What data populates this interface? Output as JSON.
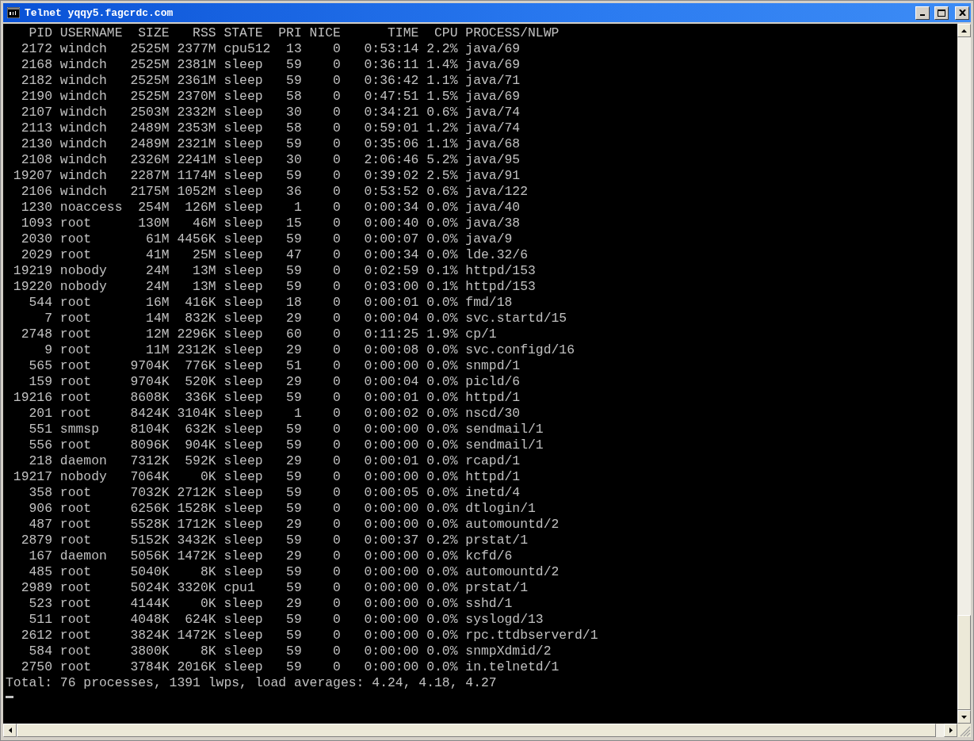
{
  "window": {
    "title": "Telnet yqqy5.fagcrdc.com"
  },
  "header": {
    "pid": "PID",
    "username": "USERNAME",
    "size": "SIZE",
    "rss": "RSS",
    "state": "STATE",
    "pri": "PRI",
    "nice": "NICE",
    "time": "TIME",
    "cpu": "CPU",
    "process": "PROCESS/NLWP"
  },
  "rows": [
    {
      "pid": "2172",
      "username": "windch",
      "size": "2525M",
      "rss": "2377M",
      "state": "cpu512",
      "pri": "13",
      "nice": "0",
      "time": "0:53:14",
      "cpu": "2.2%",
      "process": "java/69"
    },
    {
      "pid": "2168",
      "username": "windch",
      "size": "2525M",
      "rss": "2381M",
      "state": "sleep",
      "pri": "59",
      "nice": "0",
      "time": "0:36:11",
      "cpu": "1.4%",
      "process": "java/69"
    },
    {
      "pid": "2182",
      "username": "windch",
      "size": "2525M",
      "rss": "2361M",
      "state": "sleep",
      "pri": "59",
      "nice": "0",
      "time": "0:36:42",
      "cpu": "1.1%",
      "process": "java/71"
    },
    {
      "pid": "2190",
      "username": "windch",
      "size": "2525M",
      "rss": "2370M",
      "state": "sleep",
      "pri": "58",
      "nice": "0",
      "time": "0:47:51",
      "cpu": "1.5%",
      "process": "java/69"
    },
    {
      "pid": "2107",
      "username": "windch",
      "size": "2503M",
      "rss": "2332M",
      "state": "sleep",
      "pri": "30",
      "nice": "0",
      "time": "0:34:21",
      "cpu": "0.6%",
      "process": "java/74"
    },
    {
      "pid": "2113",
      "username": "windch",
      "size": "2489M",
      "rss": "2353M",
      "state": "sleep",
      "pri": "58",
      "nice": "0",
      "time": "0:59:01",
      "cpu": "1.2%",
      "process": "java/74"
    },
    {
      "pid": "2130",
      "username": "windch",
      "size": "2489M",
      "rss": "2321M",
      "state": "sleep",
      "pri": "59",
      "nice": "0",
      "time": "0:35:06",
      "cpu": "1.1%",
      "process": "java/68"
    },
    {
      "pid": "2108",
      "username": "windch",
      "size": "2326M",
      "rss": "2241M",
      "state": "sleep",
      "pri": "30",
      "nice": "0",
      "time": "2:06:46",
      "cpu": "5.2%",
      "process": "java/95"
    },
    {
      "pid": "19207",
      "username": "windch",
      "size": "2287M",
      "rss": "1174M",
      "state": "sleep",
      "pri": "59",
      "nice": "0",
      "time": "0:39:02",
      "cpu": "2.5%",
      "process": "java/91"
    },
    {
      "pid": "2106",
      "username": "windch",
      "size": "2175M",
      "rss": "1052M",
      "state": "sleep",
      "pri": "36",
      "nice": "0",
      "time": "0:53:52",
      "cpu": "0.6%",
      "process": "java/122"
    },
    {
      "pid": "1230",
      "username": "noaccess",
      "size": "254M",
      "rss": "126M",
      "state": "sleep",
      "pri": "1",
      "nice": "0",
      "time": "0:00:34",
      "cpu": "0.0%",
      "process": "java/40"
    },
    {
      "pid": "1093",
      "username": "root",
      "size": "130M",
      "rss": "46M",
      "state": "sleep",
      "pri": "15",
      "nice": "0",
      "time": "0:00:40",
      "cpu": "0.0%",
      "process": "java/38"
    },
    {
      "pid": "2030",
      "username": "root",
      "size": "61M",
      "rss": "4456K",
      "state": "sleep",
      "pri": "59",
      "nice": "0",
      "time": "0:00:07",
      "cpu": "0.0%",
      "process": "java/9"
    },
    {
      "pid": "2029",
      "username": "root",
      "size": "41M",
      "rss": "25M",
      "state": "sleep",
      "pri": "47",
      "nice": "0",
      "time": "0:00:34",
      "cpu": "0.0%",
      "process": "lde.32/6"
    },
    {
      "pid": "19219",
      "username": "nobody",
      "size": "24M",
      "rss": "13M",
      "state": "sleep",
      "pri": "59",
      "nice": "0",
      "time": "0:02:59",
      "cpu": "0.1%",
      "process": "httpd/153"
    },
    {
      "pid": "19220",
      "username": "nobody",
      "size": "24M",
      "rss": "13M",
      "state": "sleep",
      "pri": "59",
      "nice": "0",
      "time": "0:03:00",
      "cpu": "0.1%",
      "process": "httpd/153"
    },
    {
      "pid": "544",
      "username": "root",
      "size": "16M",
      "rss": "416K",
      "state": "sleep",
      "pri": "18",
      "nice": "0",
      "time": "0:00:01",
      "cpu": "0.0%",
      "process": "fmd/18"
    },
    {
      "pid": "7",
      "username": "root",
      "size": "14M",
      "rss": "832K",
      "state": "sleep",
      "pri": "29",
      "nice": "0",
      "time": "0:00:04",
      "cpu": "0.0%",
      "process": "svc.startd/15"
    },
    {
      "pid": "2748",
      "username": "root",
      "size": "12M",
      "rss": "2296K",
      "state": "sleep",
      "pri": "60",
      "nice": "0",
      "time": "0:11:25",
      "cpu": "1.9%",
      "process": "cp/1"
    },
    {
      "pid": "9",
      "username": "root",
      "size": "11M",
      "rss": "2312K",
      "state": "sleep",
      "pri": "29",
      "nice": "0",
      "time": "0:00:08",
      "cpu": "0.0%",
      "process": "svc.configd/16"
    },
    {
      "pid": "565",
      "username": "root",
      "size": "9704K",
      "rss": "776K",
      "state": "sleep",
      "pri": "51",
      "nice": "0",
      "time": "0:00:00",
      "cpu": "0.0%",
      "process": "snmpd/1"
    },
    {
      "pid": "159",
      "username": "root",
      "size": "9704K",
      "rss": "520K",
      "state": "sleep",
      "pri": "29",
      "nice": "0",
      "time": "0:00:04",
      "cpu": "0.0%",
      "process": "picld/6"
    },
    {
      "pid": "19216",
      "username": "root",
      "size": "8608K",
      "rss": "336K",
      "state": "sleep",
      "pri": "59",
      "nice": "0",
      "time": "0:00:01",
      "cpu": "0.0%",
      "process": "httpd/1"
    },
    {
      "pid": "201",
      "username": "root",
      "size": "8424K",
      "rss": "3104K",
      "state": "sleep",
      "pri": "1",
      "nice": "0",
      "time": "0:00:02",
      "cpu": "0.0%",
      "process": "nscd/30"
    },
    {
      "pid": "551",
      "username": "smmsp",
      "size": "8104K",
      "rss": "632K",
      "state": "sleep",
      "pri": "59",
      "nice": "0",
      "time": "0:00:00",
      "cpu": "0.0%",
      "process": "sendmail/1"
    },
    {
      "pid": "556",
      "username": "root",
      "size": "8096K",
      "rss": "904K",
      "state": "sleep",
      "pri": "59",
      "nice": "0",
      "time": "0:00:00",
      "cpu": "0.0%",
      "process": "sendmail/1"
    },
    {
      "pid": "218",
      "username": "daemon",
      "size": "7312K",
      "rss": "592K",
      "state": "sleep",
      "pri": "29",
      "nice": "0",
      "time": "0:00:01",
      "cpu": "0.0%",
      "process": "rcapd/1"
    },
    {
      "pid": "19217",
      "username": "nobody",
      "size": "7064K",
      "rss": "0K",
      "state": "sleep",
      "pri": "59",
      "nice": "0",
      "time": "0:00:00",
      "cpu": "0.0%",
      "process": "httpd/1"
    },
    {
      "pid": "358",
      "username": "root",
      "size": "7032K",
      "rss": "2712K",
      "state": "sleep",
      "pri": "59",
      "nice": "0",
      "time": "0:00:05",
      "cpu": "0.0%",
      "process": "inetd/4"
    },
    {
      "pid": "906",
      "username": "root",
      "size": "6256K",
      "rss": "1528K",
      "state": "sleep",
      "pri": "59",
      "nice": "0",
      "time": "0:00:00",
      "cpu": "0.0%",
      "process": "dtlogin/1"
    },
    {
      "pid": "487",
      "username": "root",
      "size": "5528K",
      "rss": "1712K",
      "state": "sleep",
      "pri": "29",
      "nice": "0",
      "time": "0:00:00",
      "cpu": "0.0%",
      "process": "automountd/2"
    },
    {
      "pid": "2879",
      "username": "root",
      "size": "5152K",
      "rss": "3432K",
      "state": "sleep",
      "pri": "59",
      "nice": "0",
      "time": "0:00:37",
      "cpu": "0.2%",
      "process": "prstat/1"
    },
    {
      "pid": "167",
      "username": "daemon",
      "size": "5056K",
      "rss": "1472K",
      "state": "sleep",
      "pri": "29",
      "nice": "0",
      "time": "0:00:00",
      "cpu": "0.0%",
      "process": "kcfd/6"
    },
    {
      "pid": "485",
      "username": "root",
      "size": "5040K",
      "rss": "8K",
      "state": "sleep",
      "pri": "59",
      "nice": "0",
      "time": "0:00:00",
      "cpu": "0.0%",
      "process": "automountd/2"
    },
    {
      "pid": "2989",
      "username": "root",
      "size": "5024K",
      "rss": "3320K",
      "state": "cpu1",
      "pri": "59",
      "nice": "0",
      "time": "0:00:00",
      "cpu": "0.0%",
      "process": "prstat/1"
    },
    {
      "pid": "523",
      "username": "root",
      "size": "4144K",
      "rss": "0K",
      "state": "sleep",
      "pri": "29",
      "nice": "0",
      "time": "0:00:00",
      "cpu": "0.0%",
      "process": "sshd/1"
    },
    {
      "pid": "511",
      "username": "root",
      "size": "4048K",
      "rss": "624K",
      "state": "sleep",
      "pri": "59",
      "nice": "0",
      "time": "0:00:00",
      "cpu": "0.0%",
      "process": "syslogd/13"
    },
    {
      "pid": "2612",
      "username": "root",
      "size": "3824K",
      "rss": "1472K",
      "state": "sleep",
      "pri": "59",
      "nice": "0",
      "time": "0:00:00",
      "cpu": "0.0%",
      "process": "rpc.ttdbserverd/1"
    },
    {
      "pid": "584",
      "username": "root",
      "size": "3800K",
      "rss": "8K",
      "state": "sleep",
      "pri": "59",
      "nice": "0",
      "time": "0:00:00",
      "cpu": "0.0%",
      "process": "snmpXdmid/2"
    },
    {
      "pid": "2750",
      "username": "root",
      "size": "3784K",
      "rss": "2016K",
      "state": "sleep",
      "pri": "59",
      "nice": "0",
      "time": "0:00:00",
      "cpu": "0.0%",
      "process": "in.telnetd/1"
    }
  ],
  "summary": "Total: 76 processes, 1391 lwps, load averages: 4.24, 4.18, 4.27"
}
